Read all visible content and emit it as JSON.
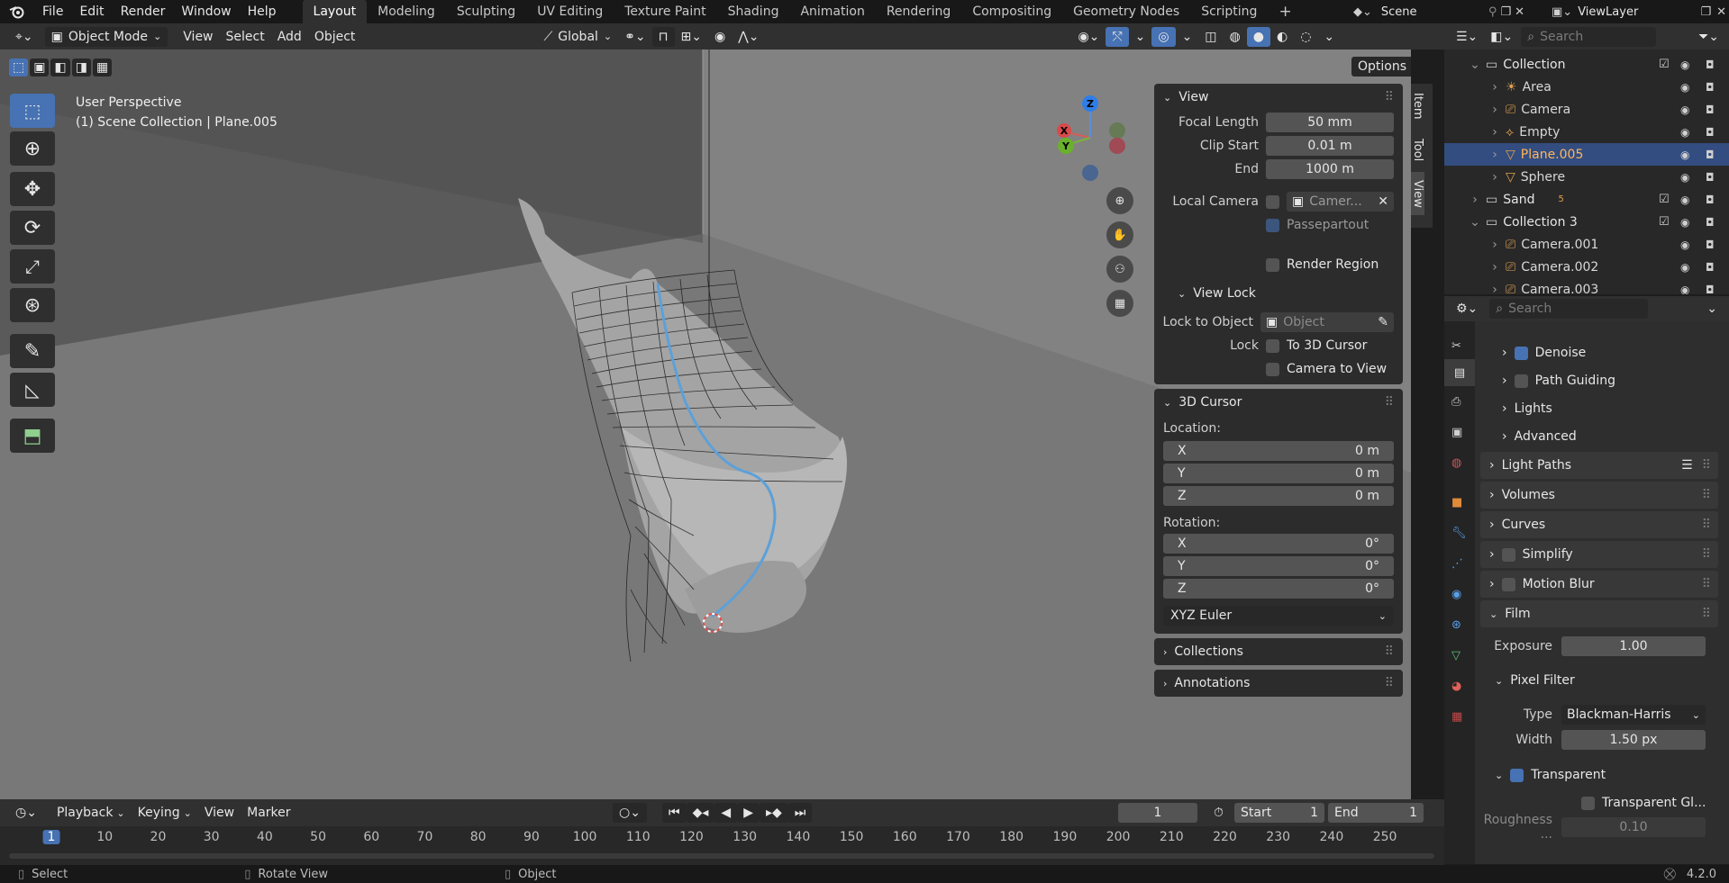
{
  "topbar": {
    "menus": [
      "File",
      "Edit",
      "Render",
      "Window",
      "Help"
    ],
    "workspaces": [
      "Layout",
      "Modeling",
      "Sculpting",
      "UV Editing",
      "Texture Paint",
      "Shading",
      "Animation",
      "Rendering",
      "Compositing",
      "Geometry Nodes",
      "Scripting"
    ],
    "active_workspace": "Layout",
    "add_tab": "+",
    "scene": "Scene",
    "view_layer": "ViewLayer"
  },
  "viewport_header": {
    "mode": "Object Mode",
    "menus": [
      "View",
      "Select",
      "Add",
      "Object"
    ],
    "orientation": "Global",
    "options": "Options"
  },
  "viewport": {
    "perspective": "User Perspective",
    "context": "(1) Scene Collection | Plane.005",
    "gizmo": {
      "z": "Z",
      "x": "X",
      "y": "Y"
    }
  },
  "side_tabs": [
    "Item",
    "Tool",
    "View"
  ],
  "npanel": {
    "view": {
      "title": "View",
      "focal_length_label": "Focal Length",
      "focal_length": "50 mm",
      "clip_start_label": "Clip Start",
      "clip_start": "0.01 m",
      "end_label": "End",
      "end": "1000 m",
      "local_camera_label": "Local Camera",
      "local_camera": "Camer...",
      "passepartout": "Passepartout",
      "render_region": "Render Region"
    },
    "view_lock": {
      "title": "View Lock",
      "lock_to_object_label": "Lock to Object",
      "lock_to_object_placeholder": "Object",
      "lock_label": "Lock",
      "to_3d_cursor": "To 3D Cursor",
      "camera_to_view": "Camera to View"
    },
    "cursor": {
      "title": "3D Cursor",
      "location_label": "Location:",
      "location": [
        {
          "axis": "X",
          "value": "0 m"
        },
        {
          "axis": "Y",
          "value": "0 m"
        },
        {
          "axis": "Z",
          "value": "0 m"
        }
      ],
      "rotation_label": "Rotation:",
      "rotation": [
        {
          "axis": "X",
          "value": "0°"
        },
        {
          "axis": "Y",
          "value": "0°"
        },
        {
          "axis": "Z",
          "value": "0°"
        }
      ],
      "rotation_mode": "XYZ Euler"
    },
    "collections": "Collections",
    "annotations": "Annotations"
  },
  "outliner": {
    "search_placeholder": "Search",
    "rows": [
      {
        "name": "Collection",
        "type": "collection"
      },
      {
        "name": "Area",
        "type": "light"
      },
      {
        "name": "Camera",
        "type": "camera"
      },
      {
        "name": "Empty",
        "type": "empty"
      },
      {
        "name": "Plane.005",
        "type": "mesh",
        "selected": true
      },
      {
        "name": "Sphere",
        "type": "mesh"
      },
      {
        "name": "Sand",
        "type": "collection",
        "badge": "5"
      },
      {
        "name": "Collection 3",
        "type": "collection"
      },
      {
        "name": "Camera.001",
        "type": "camera"
      },
      {
        "name": "Camera.002",
        "type": "camera"
      },
      {
        "name": "Camera.003",
        "type": "camera"
      }
    ]
  },
  "properties": {
    "search_placeholder": "Search",
    "denoise": "Denoise",
    "path_guiding": "Path Guiding",
    "lights": "Lights",
    "advanced": "Advanced",
    "light_paths": "Light Paths",
    "volumes": "Volumes",
    "curves": "Curves",
    "simplify": "Simplify",
    "motion_blur": "Motion Blur",
    "film": "Film",
    "exposure_label": "Exposure",
    "exposure": "1.00",
    "pixel_filter": "Pixel Filter",
    "type_label": "Type",
    "type": "Blackman-Harris",
    "width_label": "Width",
    "width": "1.50 px",
    "transparent": "Transparent",
    "transparent_glass": "Transparent Gl...",
    "roughness_label": "Roughness ...",
    "roughness": "0.10"
  },
  "timeline": {
    "menus": [
      "Playback",
      "Keying",
      "View",
      "Marker"
    ],
    "current_frame": "1",
    "start_label": "Start",
    "start": "1",
    "end_label": "End",
    "end": "1",
    "ticks": [
      "1",
      "10",
      "20",
      "30",
      "40",
      "50",
      "60",
      "70",
      "80",
      "90",
      "100",
      "110",
      "120",
      "130",
      "140",
      "150",
      "160",
      "170",
      "180",
      "190",
      "200",
      "210",
      "220",
      "230",
      "240",
      "250"
    ]
  },
  "status": {
    "select": "Select",
    "rotate_view": "Rotate View",
    "object": "Object",
    "version": "4.2.0"
  },
  "colors": {
    "accent": "#4772b3",
    "selected_row": "#334d80",
    "collection_text": "#e6e6e6"
  }
}
